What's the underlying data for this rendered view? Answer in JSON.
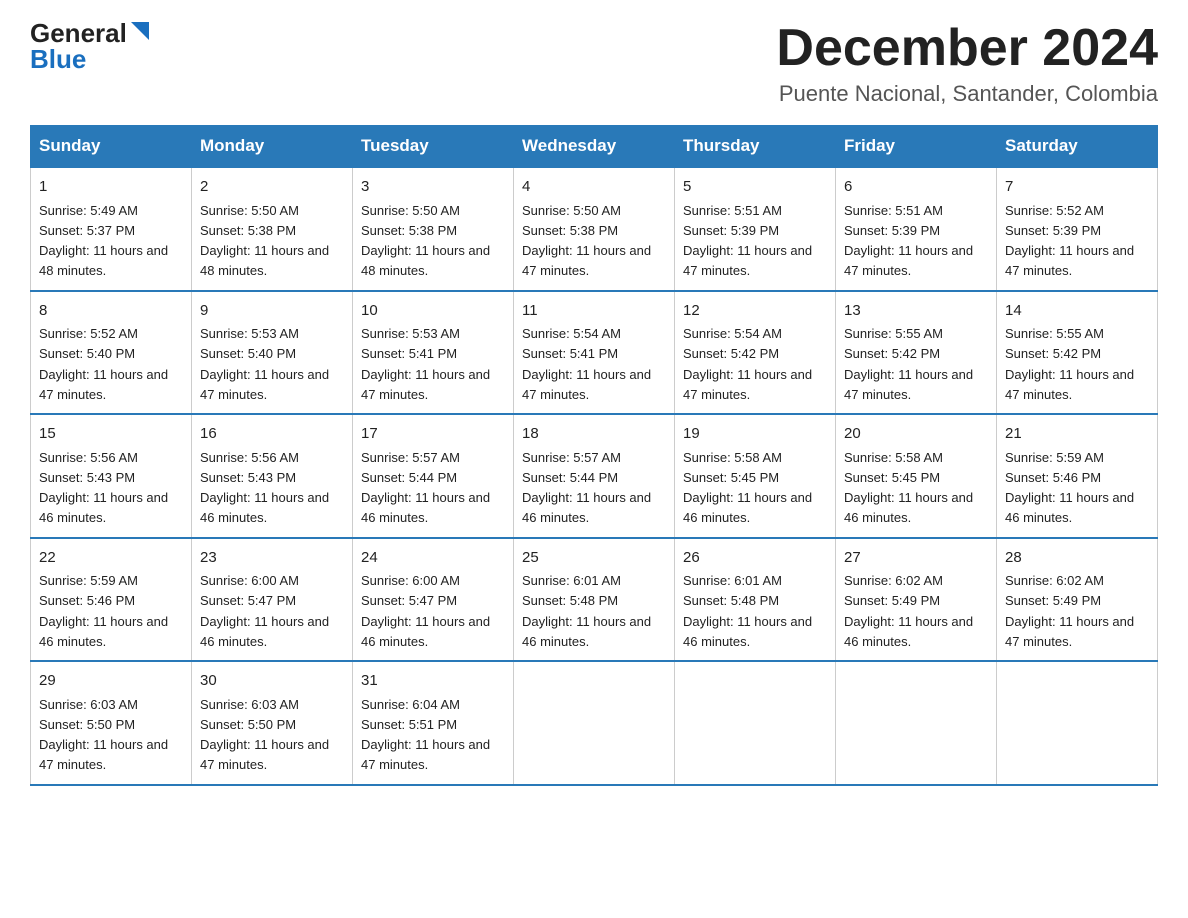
{
  "header": {
    "logo_general": "General",
    "logo_blue": "Blue",
    "month_title": "December 2024",
    "location": "Puente Nacional, Santander, Colombia"
  },
  "columns": [
    "Sunday",
    "Monday",
    "Tuesday",
    "Wednesday",
    "Thursday",
    "Friday",
    "Saturday"
  ],
  "weeks": [
    [
      {
        "day": "1",
        "sunrise": "5:49 AM",
        "sunset": "5:37 PM",
        "daylight": "11 hours and 48 minutes."
      },
      {
        "day": "2",
        "sunrise": "5:50 AM",
        "sunset": "5:38 PM",
        "daylight": "11 hours and 48 minutes."
      },
      {
        "day": "3",
        "sunrise": "5:50 AM",
        "sunset": "5:38 PM",
        "daylight": "11 hours and 48 minutes."
      },
      {
        "day": "4",
        "sunrise": "5:50 AM",
        "sunset": "5:38 PM",
        "daylight": "11 hours and 47 minutes."
      },
      {
        "day": "5",
        "sunrise": "5:51 AM",
        "sunset": "5:39 PM",
        "daylight": "11 hours and 47 minutes."
      },
      {
        "day": "6",
        "sunrise": "5:51 AM",
        "sunset": "5:39 PM",
        "daylight": "11 hours and 47 minutes."
      },
      {
        "day": "7",
        "sunrise": "5:52 AM",
        "sunset": "5:39 PM",
        "daylight": "11 hours and 47 minutes."
      }
    ],
    [
      {
        "day": "8",
        "sunrise": "5:52 AM",
        "sunset": "5:40 PM",
        "daylight": "11 hours and 47 minutes."
      },
      {
        "day": "9",
        "sunrise": "5:53 AM",
        "sunset": "5:40 PM",
        "daylight": "11 hours and 47 minutes."
      },
      {
        "day": "10",
        "sunrise": "5:53 AM",
        "sunset": "5:41 PM",
        "daylight": "11 hours and 47 minutes."
      },
      {
        "day": "11",
        "sunrise": "5:54 AM",
        "sunset": "5:41 PM",
        "daylight": "11 hours and 47 minutes."
      },
      {
        "day": "12",
        "sunrise": "5:54 AM",
        "sunset": "5:42 PM",
        "daylight": "11 hours and 47 minutes."
      },
      {
        "day": "13",
        "sunrise": "5:55 AM",
        "sunset": "5:42 PM",
        "daylight": "11 hours and 47 minutes."
      },
      {
        "day": "14",
        "sunrise": "5:55 AM",
        "sunset": "5:42 PM",
        "daylight": "11 hours and 47 minutes."
      }
    ],
    [
      {
        "day": "15",
        "sunrise": "5:56 AM",
        "sunset": "5:43 PM",
        "daylight": "11 hours and 46 minutes."
      },
      {
        "day": "16",
        "sunrise": "5:56 AM",
        "sunset": "5:43 PM",
        "daylight": "11 hours and 46 minutes."
      },
      {
        "day": "17",
        "sunrise": "5:57 AM",
        "sunset": "5:44 PM",
        "daylight": "11 hours and 46 minutes."
      },
      {
        "day": "18",
        "sunrise": "5:57 AM",
        "sunset": "5:44 PM",
        "daylight": "11 hours and 46 minutes."
      },
      {
        "day": "19",
        "sunrise": "5:58 AM",
        "sunset": "5:45 PM",
        "daylight": "11 hours and 46 minutes."
      },
      {
        "day": "20",
        "sunrise": "5:58 AM",
        "sunset": "5:45 PM",
        "daylight": "11 hours and 46 minutes."
      },
      {
        "day": "21",
        "sunrise": "5:59 AM",
        "sunset": "5:46 PM",
        "daylight": "11 hours and 46 minutes."
      }
    ],
    [
      {
        "day": "22",
        "sunrise": "5:59 AM",
        "sunset": "5:46 PM",
        "daylight": "11 hours and 46 minutes."
      },
      {
        "day": "23",
        "sunrise": "6:00 AM",
        "sunset": "5:47 PM",
        "daylight": "11 hours and 46 minutes."
      },
      {
        "day": "24",
        "sunrise": "6:00 AM",
        "sunset": "5:47 PM",
        "daylight": "11 hours and 46 minutes."
      },
      {
        "day": "25",
        "sunrise": "6:01 AM",
        "sunset": "5:48 PM",
        "daylight": "11 hours and 46 minutes."
      },
      {
        "day": "26",
        "sunrise": "6:01 AM",
        "sunset": "5:48 PM",
        "daylight": "11 hours and 46 minutes."
      },
      {
        "day": "27",
        "sunrise": "6:02 AM",
        "sunset": "5:49 PM",
        "daylight": "11 hours and 46 minutes."
      },
      {
        "day": "28",
        "sunrise": "6:02 AM",
        "sunset": "5:49 PM",
        "daylight": "11 hours and 47 minutes."
      }
    ],
    [
      {
        "day": "29",
        "sunrise": "6:03 AM",
        "sunset": "5:50 PM",
        "daylight": "11 hours and 47 minutes."
      },
      {
        "day": "30",
        "sunrise": "6:03 AM",
        "sunset": "5:50 PM",
        "daylight": "11 hours and 47 minutes."
      },
      {
        "day": "31",
        "sunrise": "6:04 AM",
        "sunset": "5:51 PM",
        "daylight": "11 hours and 47 minutes."
      },
      null,
      null,
      null,
      null
    ]
  ]
}
